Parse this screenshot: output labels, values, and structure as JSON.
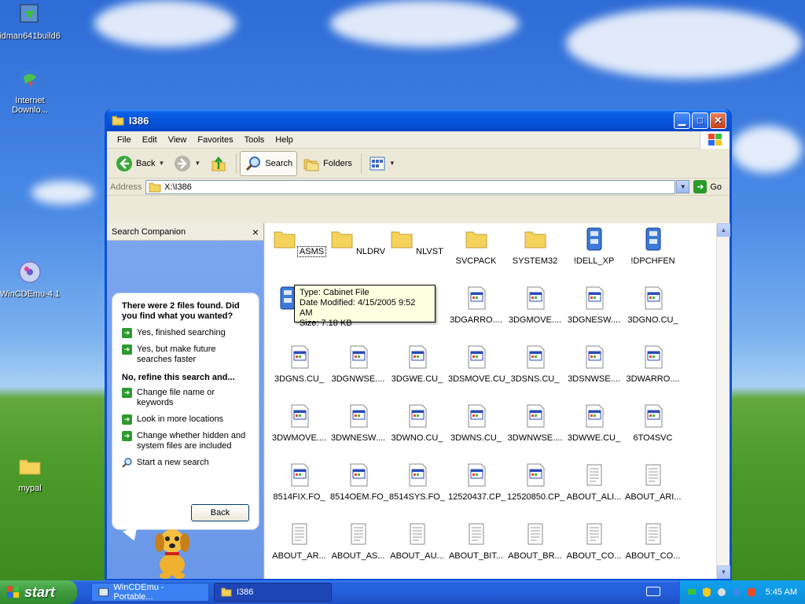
{
  "desktop": {
    "icons": [
      {
        "label": "idman641build6"
      },
      {
        "label": "Internet Downlo..."
      },
      {
        "label": "WinCDEmu-4.1"
      },
      {
        "label": "mypal"
      }
    ]
  },
  "window": {
    "title": "I386",
    "menu": [
      "File",
      "Edit",
      "View",
      "Favorites",
      "Tools",
      "Help"
    ],
    "toolbar": {
      "back": "Back",
      "search": "Search",
      "folders": "Folders"
    },
    "address": {
      "label": "Address",
      "value": "X:\\I386",
      "go": "Go"
    }
  },
  "companion": {
    "title": "Search Companion",
    "close": "×",
    "heading": "There were 2 files found. Did you find what you wanted?",
    "options_yes": [
      "Yes, finished searching",
      "Yes, but make future searches faster"
    ],
    "refine": "No, refine this search and...",
    "options_refine": [
      "Change file name or keywords",
      "Look in more locations",
      "Change whether hidden and system files are included"
    ],
    "new_search": "Start a new search",
    "back": "Back"
  },
  "files": [
    [
      "ASMS",
      "NLDRV",
      "NLVST",
      "SVCPACK",
      "SYSTEM32",
      "!DELL_XP",
      "!DPCHFEN"
    ],
    [
      "!PCV",
      "",
      "",
      "3DGARRO....",
      "3DGMOVE....",
      "3DGNESW....",
      "3DGNO.CU_"
    ],
    [
      "3DGNS.CU_",
      "3DGNWSE....",
      "3DGWE.CU_",
      "3DSMOVE.CU_",
      "3DSNS.CU_",
      "3DSNWSE....",
      "3DWARRO...."
    ],
    [
      "3DWMOVE....",
      "3DWNESW....",
      "3DWNO.CU_",
      "3DWNS.CU_",
      "3DWNWSE....",
      "3DWWE.CU_",
      "6TO4SVC"
    ],
    [
      "8514FIX.FO_",
      "8514OEM.FO_",
      "8514SYS.FO_",
      "12520437.CP_",
      "12520850.CP_",
      "ABOUT_ALI...",
      "ABOUT_ARI..."
    ],
    [
      "ABOUT_AR...",
      "ABOUT_AS...",
      "ABOUT_AU...",
      "ABOUT_BIT...",
      "ABOUT_BR...",
      "ABOUT_CO...",
      "ABOUT_CO..."
    ]
  ],
  "tooltip": {
    "type": "Type: Cabinet File",
    "modified": "Date Modified: 4/15/2005 9:52 AM",
    "size": "Size: 7.18 KB"
  },
  "taskbar": {
    "start": "start",
    "tasks": [
      "WinCDEmu - Portable...",
      "I386"
    ],
    "clock": "5:45 AM"
  },
  "colors": {
    "title_blue": "#0552d8",
    "start_green": "#3c9a3c",
    "folder_yellow": "#f5d25a"
  }
}
